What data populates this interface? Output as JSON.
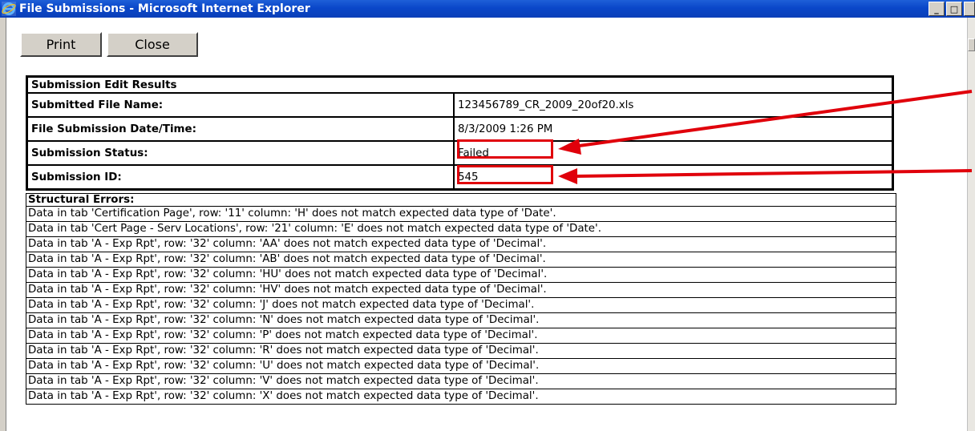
{
  "window": {
    "title": "File Submissions - Microsoft Internet Explorer",
    "minimize_glyph": "_",
    "maximize_glyph": "□"
  },
  "toolbar": {
    "print_label": "Print",
    "close_label": "Close"
  },
  "results": {
    "header": "Submission Edit Results",
    "rows": [
      {
        "label": "Submitted File Name:",
        "value": "123456789_CR_2009_20of20.xls"
      },
      {
        "label": "File Submission Date/Time:",
        "value": "8/3/2009 1:26 PM"
      },
      {
        "label": "Submission Status:",
        "value": "Failed"
      },
      {
        "label": "Submission ID:",
        "value": "545"
      }
    ]
  },
  "errors": {
    "header": "Structural Errors:",
    "items": [
      "Data in tab 'Certification Page', row: '11' column: 'H' does not match expected data type of 'Date'.",
      "Data in tab 'Cert Page - Serv Locations', row: '21' column: 'E' does not match expected data type of 'Date'.",
      "Data in tab 'A - Exp Rpt', row: '32' column: 'AA' does not match expected data type of 'Decimal'.",
      "Data in tab 'A - Exp Rpt', row: '32' column: 'AB' does not match expected data type of 'Decimal'.",
      "Data in tab 'A - Exp Rpt', row: '32' column: 'HU' does not match expected data type of 'Decimal'.",
      "Data in tab 'A - Exp Rpt', row: '32' column: 'HV' does not match expected data type of 'Decimal'.",
      "Data in tab 'A - Exp Rpt', row: '32' column: 'J' does not match expected data type of 'Decimal'.",
      "Data in tab 'A - Exp Rpt', row: '32' column: 'N' does not match expected data type of 'Decimal'.",
      "Data in tab 'A - Exp Rpt', row: '32' column: 'P' does not match expected data type of 'Decimal'.",
      "Data in tab 'A - Exp Rpt', row: '32' column: 'R' does not match expected data type of 'Decimal'.",
      "Data in tab 'A - Exp Rpt', row: '32' column: 'U' does not match expected data type of 'Decimal'.",
      "Data in tab 'A - Exp Rpt', row: '32' column: 'V' does not match expected data type of 'Decimal'.",
      "Data in tab 'A - Exp Rpt', row: '32' column: 'X' does not match expected data type of 'Decimal'."
    ]
  },
  "colors": {
    "titlebar": "#0a47c9",
    "highlight": "#e0000b",
    "button_face": "#d4d0c8"
  },
  "icons": {
    "app_icon": "internet-explorer-icon",
    "callout": "red-arrow-icon"
  }
}
